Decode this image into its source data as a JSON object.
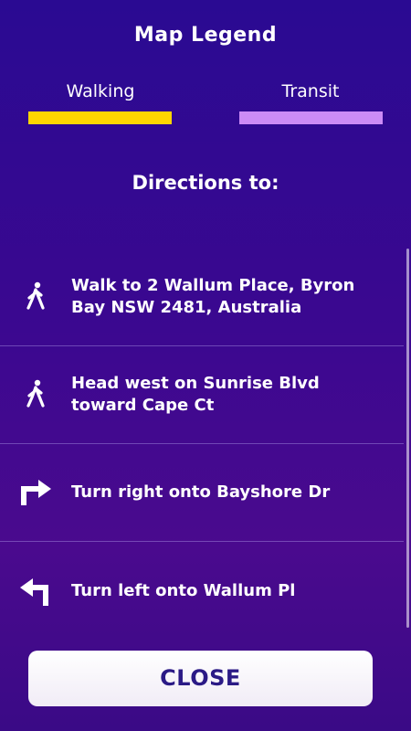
{
  "legend": {
    "title": "Map Legend",
    "items": [
      {
        "label": "Walking",
        "color": "#ffd600"
      },
      {
        "label": "Transit",
        "color": "#cc8bf6"
      }
    ]
  },
  "directions": {
    "title": "Directions to:",
    "steps": [
      {
        "icon": "walking-person-icon",
        "text": "Walk to 2 Wallum Place, Byron Bay NSW 2481, Australia"
      },
      {
        "icon": "walking-person-icon",
        "text": "Head west on Sunrise Blvd toward Cape Ct"
      },
      {
        "icon": "turn-right-arrow-icon",
        "text": "Turn right onto Bayshore Dr"
      },
      {
        "icon": "turn-left-arrow-icon",
        "text": "Turn left onto Wallum Pl"
      }
    ]
  },
  "close_button": {
    "label": "CLOSE"
  },
  "colors": {
    "background_top": "#2a0a92",
    "background_bottom": "#4a0a8e",
    "button_text": "#2b1a86"
  }
}
